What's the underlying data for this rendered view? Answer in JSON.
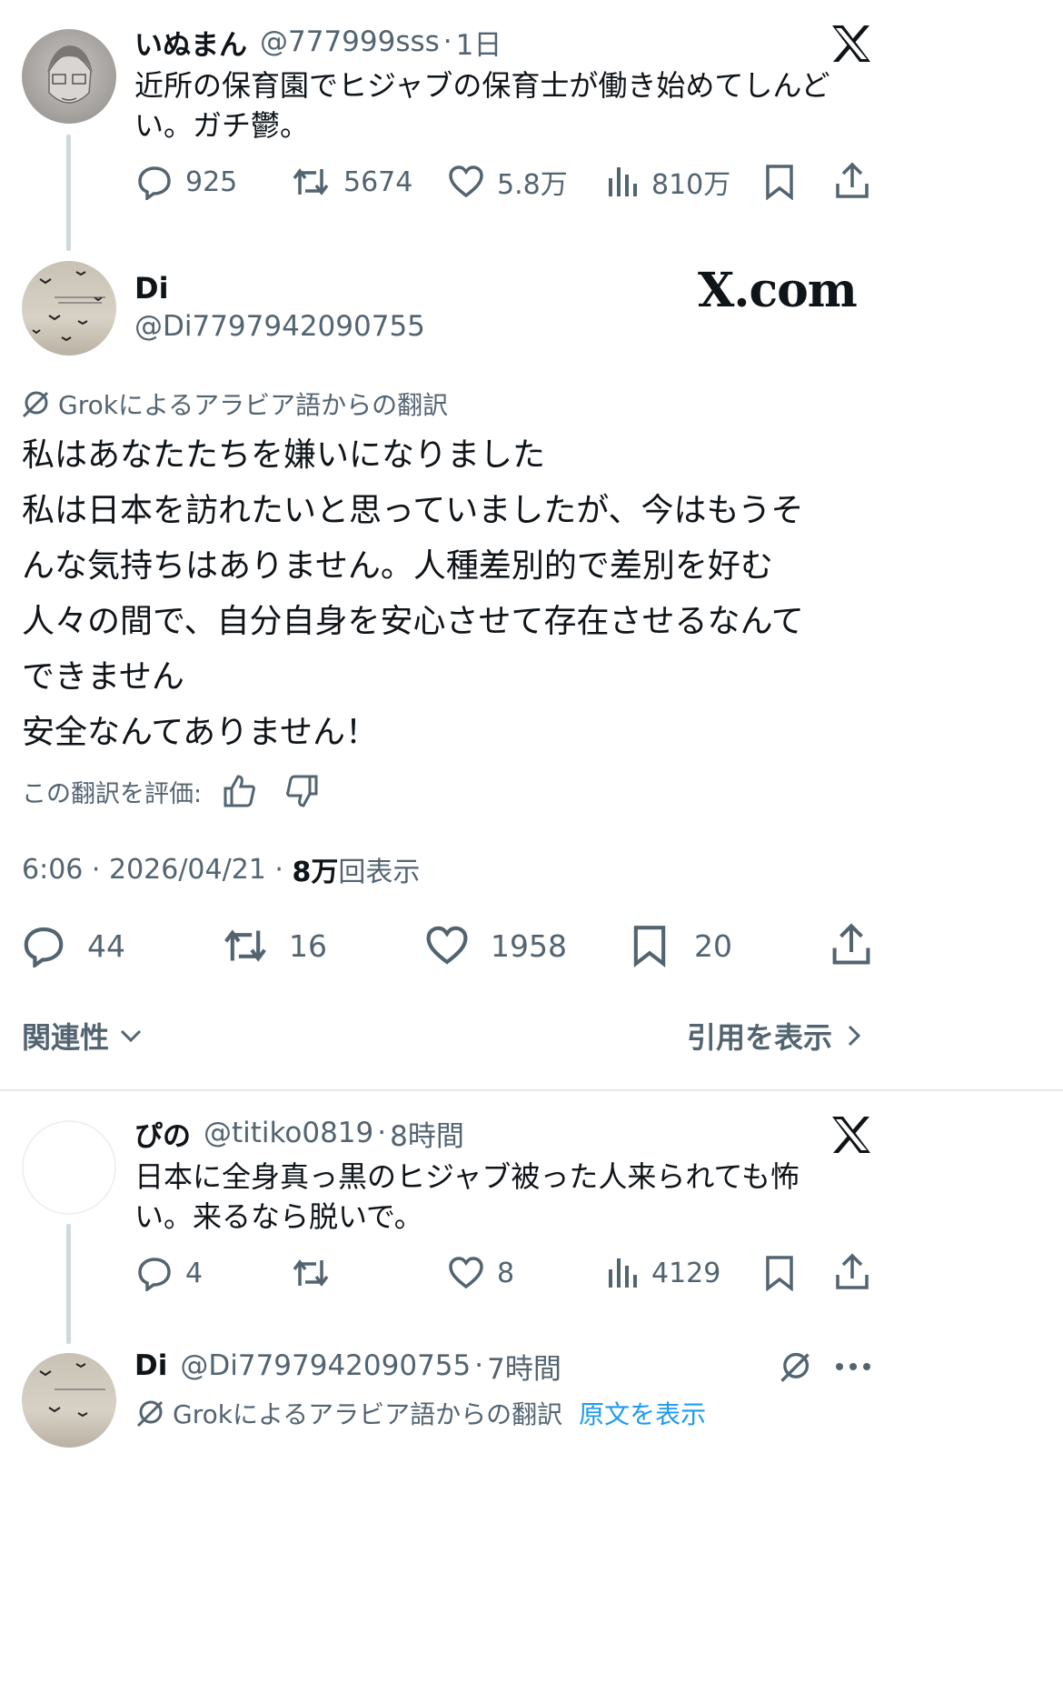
{
  "tweet1": {
    "name": "いぬまん",
    "handle": "@777999sss",
    "sep": "·",
    "time": "1日",
    "text_line1": "近所の保育園でヒジャブの保育士が働き始めてしんど",
    "text_line2": "い。ガチ鬱。",
    "replies": "925",
    "retweets": "5674",
    "likes": "5.8万",
    "views": "810万"
  },
  "main": {
    "name": "Di",
    "handle": "@Di7797942090755",
    "watermark": "X.com",
    "grok_label": "Grokによるアラビア語からの翻訳",
    "lines": [
      "私はあなたたちを嫌いになりました",
      "私は日本を訪れたいと思っていましたが、今はもうそ",
      "んな気持ちはありません。人種差別的で差別を好む",
      "人々の間で、自分自身を安心させて存在させるなんて",
      "できません",
      "安全なんてありません！"
    ],
    "rate_label": "この翻訳を評価:",
    "timestamp": "6:06 · 2026/04/21 · ",
    "views_num": "8万",
    "views_label": "回表示",
    "replies": "44",
    "retweets": "16",
    "likes": "1958",
    "bookmarks": "20",
    "sort_label": "関連性",
    "quotes_label": "引用を表示"
  },
  "reply1": {
    "name": "ぴの",
    "handle": "@titiko0819",
    "sep": "·",
    "time": "8時間",
    "text_line1": "日本に全身真っ黒のヒジャブ被った人来られても怖",
    "text_line2": "い。来るなら脱いで。",
    "replies": "4",
    "retweets": "",
    "likes": "8",
    "views": "4129"
  },
  "reply2": {
    "name": "Di",
    "handle": "@Di7797942090755",
    "sep": "·",
    "time": "7時間",
    "grok_label": "Grokによるアラビア語からの翻訳",
    "show_original": "原文を表示"
  },
  "colors": {
    "text": "#0f1419",
    "muted": "#536471",
    "link": "#1d9bf0",
    "divider": "#e6e9ea",
    "thread": "#cfd9de"
  },
  "icons": [
    "x-logo-icon",
    "reply-icon",
    "retweet-icon",
    "like-icon",
    "views-icon",
    "bookmark-icon",
    "share-icon",
    "grok-icon",
    "thumbs-up-icon",
    "thumbs-down-icon",
    "chevron-down-icon",
    "chevron-right-icon",
    "more-icon"
  ]
}
